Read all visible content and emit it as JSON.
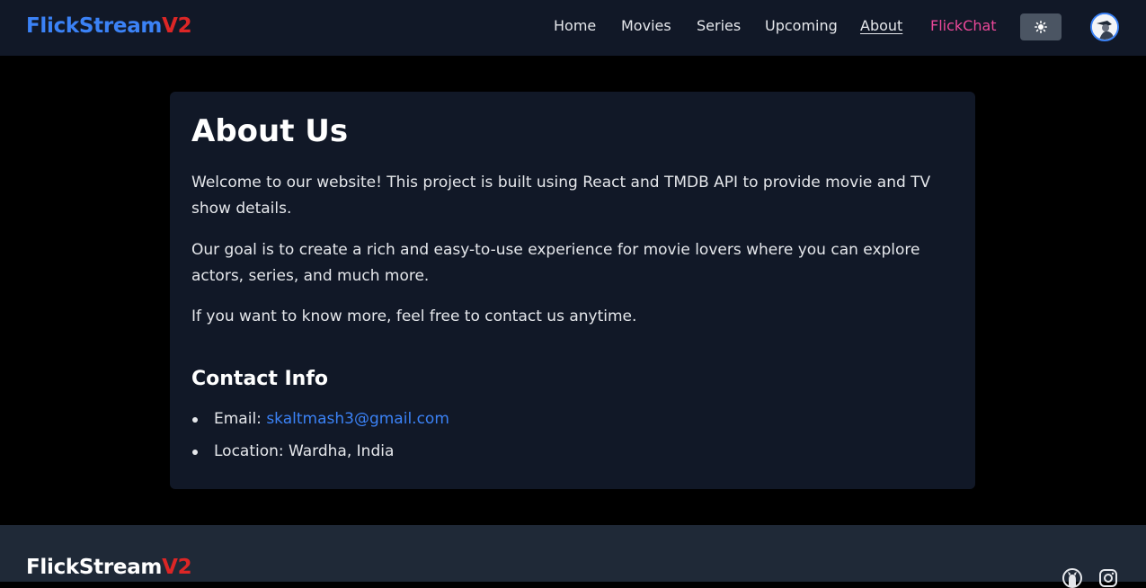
{
  "navbar": {
    "brand_main": "FlickStream",
    "brand_suffix": "V2",
    "links": [
      "Home",
      "Movies",
      "Series",
      "Upcoming",
      "About",
      "FlickChat"
    ],
    "active": "About",
    "theme_toggle_icon": "sun-icon",
    "avatar_icon": "user-avatar"
  },
  "about": {
    "title": "About Us",
    "paragraphs": [
      "Welcome to our website! This project is built using React and TMDB API to provide movie and TV show details.",
      "Our goal is to create a rich and easy-to-use experience for movie lovers where you can explore actors, series, and much more.",
      "If you want to know more, feel free to contact us anytime."
    ],
    "contact_title": "Contact Info",
    "email_label": "Email:",
    "email": "skaltmash3@gmail.com",
    "location": "Location: Wardha, India"
  },
  "footer": {
    "brand_main": "FlickStream",
    "brand_suffix": "V2",
    "social_icons": [
      "github-icon",
      "instagram-icon"
    ]
  },
  "colors": {
    "accent": "#3b82f6",
    "brand_red": "#dc2626",
    "chat_pink": "#ec4899",
    "nav_bg": "#111827",
    "footer_bg": "#1f2937"
  }
}
